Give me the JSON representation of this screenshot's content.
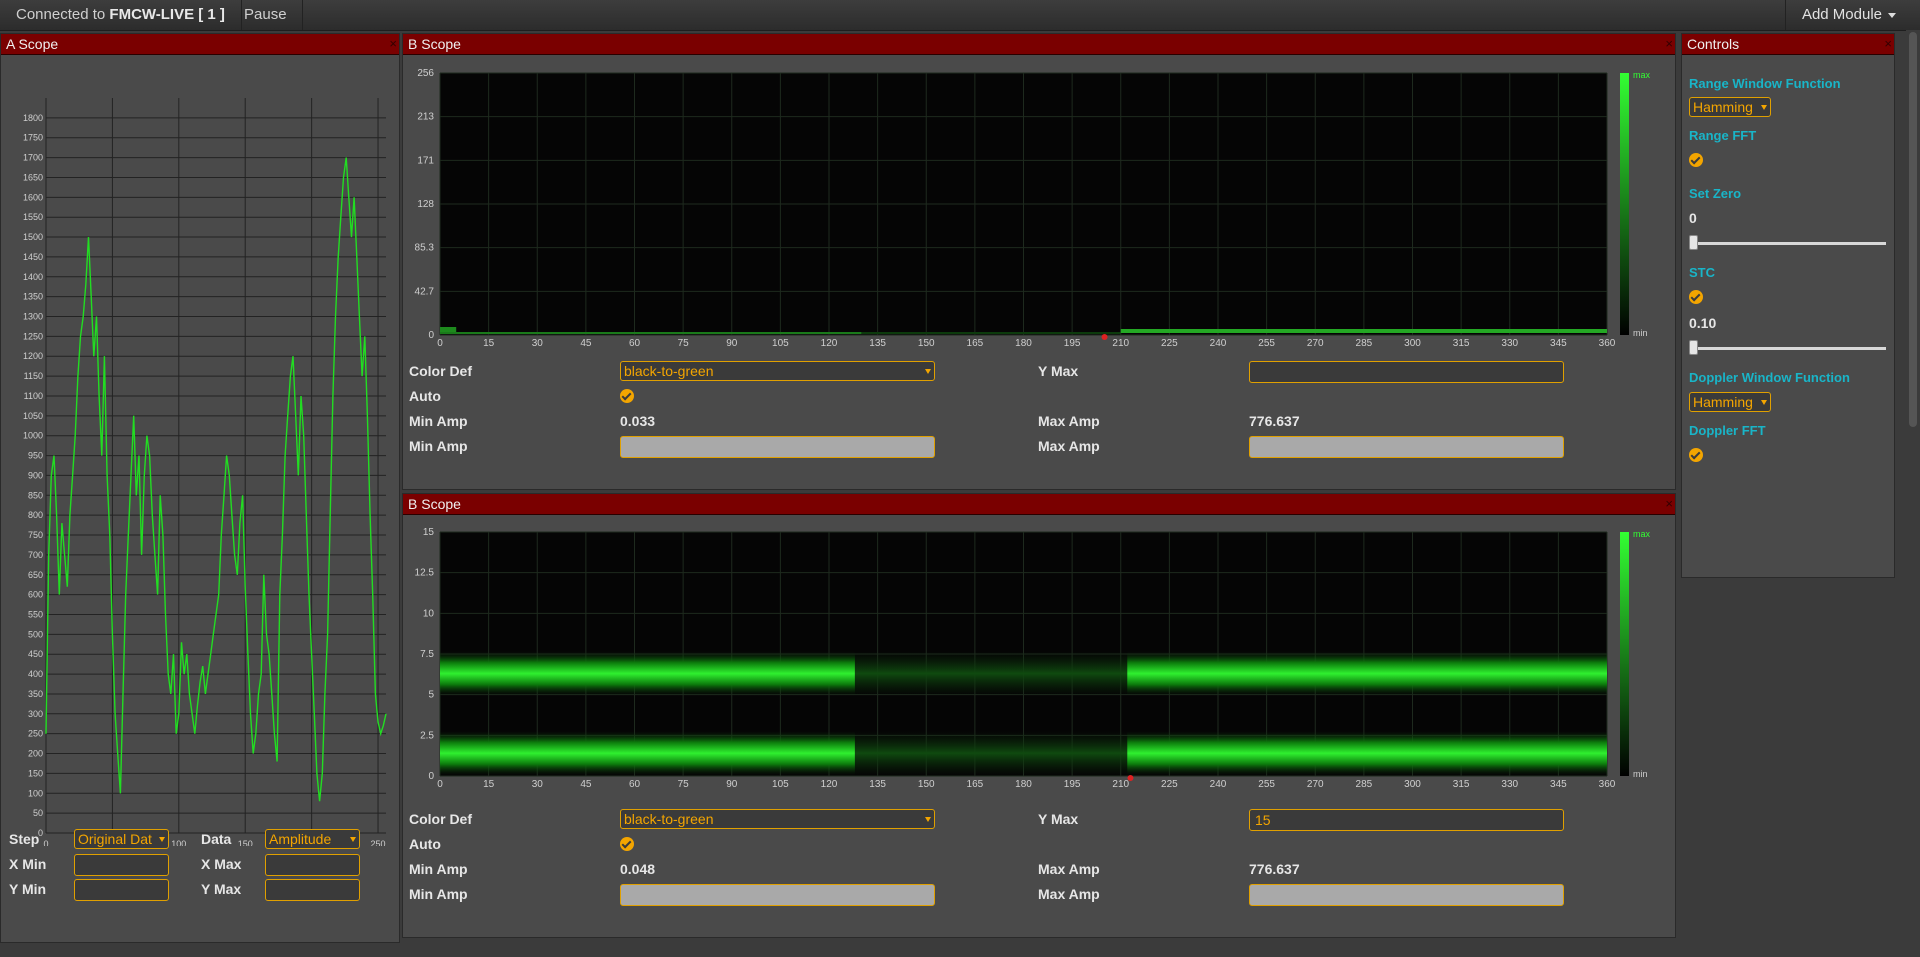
{
  "topbar": {
    "connected_prefix": "Connected to",
    "connected_name": "FMCW-LIVE [ 1 ]",
    "pause_label": "Pause",
    "add_module_label": "Add Module"
  },
  "a_scope": {
    "title": "A Scope",
    "close": "×",
    "step_label": "Step",
    "step_value": "Original Dat",
    "data_label": "Data",
    "data_value": "Amplitude",
    "xmin_label": "X Min",
    "xmax_label": "X Max",
    "ymin_label": "Y Min",
    "ymax_label": "Y Max",
    "xmin_value": "",
    "xmax_value": "",
    "ymin_value": "",
    "ymax_value": ""
  },
  "b_scope_top": {
    "title": "B Scope",
    "close": "×",
    "color_def_label": "Color Def",
    "color_def_value": "black-to-green",
    "y_max_label": "Y Max",
    "y_max_value": "",
    "auto_label": "Auto",
    "min_amp_label": "Min Amp",
    "min_amp_value": "0.033",
    "max_amp_label": "Max Amp",
    "max_amp_value": "776.637",
    "min_amp_input_label": "Min Amp",
    "max_amp_input_label": "Max Amp",
    "legend_max": "max",
    "legend_min": "min"
  },
  "b_scope_bottom": {
    "title": "B Scope",
    "close": "×",
    "color_def_label": "Color Def",
    "color_def_value": "black-to-green",
    "y_max_label": "Y Max",
    "y_max_value": "15",
    "auto_label": "Auto",
    "min_amp_label": "Min Amp",
    "min_amp_value": "0.048",
    "max_amp_label": "Max Amp",
    "max_amp_value": "776.637",
    "min_amp_input_label": "Min Amp",
    "max_amp_input_label": "Max Amp",
    "legend_max": "max",
    "legend_min": "min"
  },
  "controls": {
    "title": "Controls",
    "close": "×",
    "range_window_label": "Range Window Function",
    "range_window_value": "Hamming",
    "range_fft_label": "Range FFT",
    "set_zero_label": "Set Zero",
    "set_zero_value": "0",
    "set_zero_level": 0,
    "stc_label": "STC",
    "stc_value": "0.10",
    "stc_level": 0,
    "doppler_window_label": "Doppler Window Function",
    "doppler_window_value": "Hamming",
    "doppler_fft_label": "Doppler FFT"
  },
  "colors": {
    "header_red": "#7a0000",
    "accent_orange": "#f3a500",
    "control_cyan": "#19b5c8",
    "trace_green": "#22dd22"
  },
  "chart_data": [
    {
      "name": "a_scope_plot",
      "type": "line",
      "xlim": [
        0,
        256
      ],
      "ylim": [
        0,
        1850
      ],
      "x_ticks": [
        0,
        50,
        100,
        150,
        200,
        250
      ],
      "y_ticks": [
        0,
        50,
        100,
        150,
        200,
        250,
        300,
        350,
        400,
        450,
        500,
        550,
        600,
        650,
        700,
        750,
        800,
        850,
        900,
        950,
        1000,
        1050,
        1100,
        1150,
        1200,
        1250,
        1300,
        1350,
        1400,
        1450,
        1500,
        1550,
        1600,
        1650,
        1700,
        1750,
        1800
      ],
      "grid": true,
      "series": [
        {
          "x": [
            0,
            2,
            4,
            6,
            8,
            10,
            12,
            14,
            16,
            18,
            20,
            22,
            24,
            26,
            28,
            30,
            32,
            34,
            36,
            38,
            40,
            42,
            44,
            46,
            48,
            50,
            52,
            54,
            56,
            58,
            60,
            62,
            64,
            66,
            68,
            70,
            72,
            74,
            76,
            78,
            80,
            82,
            84,
            86,
            88,
            90,
            92,
            94,
            96,
            98,
            100,
            102,
            104,
            106,
            108,
            110,
            112,
            114,
            116,
            118,
            120,
            122,
            124,
            126,
            128,
            130,
            132,
            134,
            136,
            138,
            140,
            142,
            144,
            146,
            148,
            150,
            152,
            154,
            156,
            158,
            160,
            162,
            164,
            166,
            168,
            170,
            172,
            174,
            176,
            178,
            180,
            182,
            184,
            186,
            188,
            190,
            192,
            194,
            196,
            198,
            200,
            202,
            204,
            206,
            208,
            210,
            212,
            214,
            216,
            218,
            220,
            222,
            224,
            226,
            228,
            230,
            232,
            234,
            236,
            238,
            240,
            242,
            244,
            246,
            248,
            250,
            252,
            254,
            256
          ],
          "y": [
            250,
            700,
            900,
            950,
            800,
            600,
            780,
            700,
            620,
            800,
            900,
            1000,
            1150,
            1250,
            1300,
            1380,
            1500,
            1350,
            1200,
            1300,
            1100,
            950,
            1200,
            900,
            750,
            500,
            300,
            200,
            100,
            350,
            600,
            750,
            900,
            1050,
            850,
            950,
            700,
            900,
            1000,
            950,
            800,
            700,
            600,
            850,
            750,
            550,
            400,
            350,
            450,
            250,
            300,
            480,
            400,
            450,
            350,
            300,
            250,
            320,
            380,
            420,
            350,
            400,
            450,
            500,
            550,
            600,
            750,
            850,
            950,
            900,
            800,
            700,
            650,
            780,
            850,
            620,
            450,
            300,
            200,
            250,
            350,
            400,
            650,
            500,
            450,
            350,
            250,
            180,
            600,
            750,
            950,
            1050,
            1150,
            1200,
            1050,
            900,
            1100,
            1000,
            800,
            600,
            450,
            300,
            150,
            80,
            150,
            350,
            500,
            800,
            1100,
            1300,
            1450,
            1550,
            1650,
            1700,
            1600,
            1500,
            1600,
            1450,
            1300,
            1150,
            1250,
            1050,
            800,
            600,
            350,
            280,
            250,
            270,
            300
          ]
        }
      ]
    },
    {
      "name": "b_scope_top_heatmap",
      "type": "heatmap",
      "xlim": [
        0,
        360
      ],
      "ylim": [
        0,
        256
      ],
      "x_ticks": [
        0,
        15,
        30,
        45,
        60,
        75,
        90,
        105,
        120,
        135,
        150,
        165,
        180,
        195,
        210,
        225,
        240,
        255,
        270,
        285,
        300,
        315,
        330,
        345,
        360
      ],
      "y_ticks": [
        "0",
        "42.7",
        "85.3",
        "128",
        "171",
        "213",
        "256"
      ],
      "colormap": "black-to-green"
    },
    {
      "name": "b_scope_bottom_heatmap",
      "type": "heatmap",
      "xlim": [
        0,
        360
      ],
      "ylim": [
        0,
        15
      ],
      "x_ticks": [
        0,
        15,
        30,
        45,
        60,
        75,
        90,
        105,
        120,
        135,
        150,
        165,
        180,
        195,
        210,
        225,
        240,
        255,
        270,
        285,
        300,
        315,
        330,
        345,
        360
      ],
      "y_ticks": [
        "0",
        "2.5",
        "5",
        "7.5",
        "10",
        "12.5",
        "15"
      ],
      "colormap": "black-to-green",
      "bands_y": [
        1.4,
        6.3
      ]
    }
  ]
}
